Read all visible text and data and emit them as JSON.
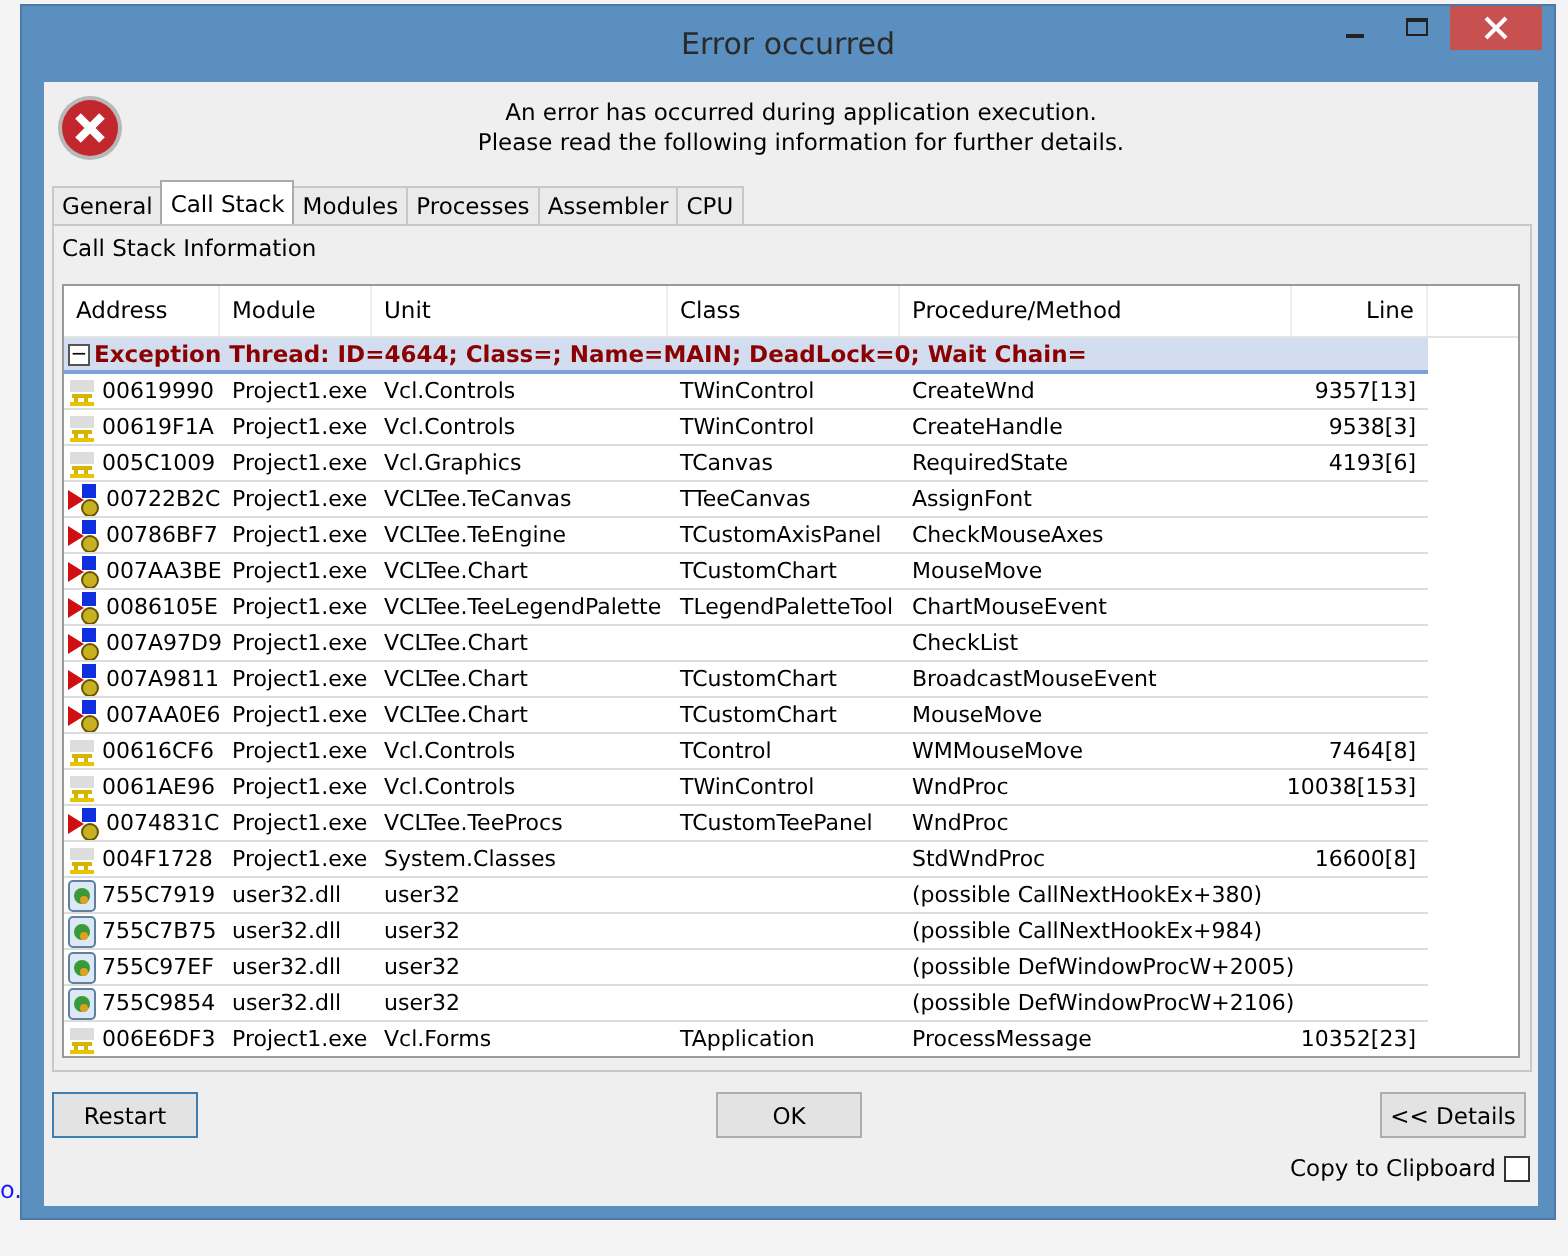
{
  "background": {
    "text": "o."
  },
  "window": {
    "title": "Error occurred"
  },
  "message": [
    "An error has occurred during application execution.",
    "Please read the following information for further details."
  ],
  "tabs": [
    {
      "label": "General",
      "selected": false
    },
    {
      "label": "Call Stack",
      "selected": true
    },
    {
      "label": "Modules",
      "selected": false
    },
    {
      "label": "Processes",
      "selected": false
    },
    {
      "label": "Assembler",
      "selected": false
    },
    {
      "label": "CPU",
      "selected": false
    }
  ],
  "section_title": "Call Stack Information",
  "table": {
    "columns": [
      "Address",
      "Module",
      "Unit",
      "Class",
      "Procedure/Method",
      "Line"
    ],
    "group": {
      "label": "Exception Thread: ID=4644; Class=; Name=MAIN; DeadLock=0; Wait Chain=",
      "expanded": true,
      "expander": "−"
    },
    "rows": [
      {
        "kind": "source",
        "cells": [
          "00619990",
          "Project1.exe",
          "Vcl.Controls",
          "TWinControl",
          "CreateWnd",
          "9357[13]"
        ]
      },
      {
        "kind": "source",
        "cells": [
          "00619F1A",
          "Project1.exe",
          "Vcl.Controls",
          "TWinControl",
          "CreateHandle",
          "9538[3]"
        ]
      },
      {
        "kind": "source",
        "cells": [
          "005C1009",
          "Project1.exe",
          "Vcl.Graphics",
          "TCanvas",
          "RequiredState",
          "4193[6]"
        ]
      },
      {
        "kind": "method",
        "cells": [
          "00722B2C",
          "Project1.exe",
          "VCLTee.TeCanvas",
          "TTeeCanvas",
          "AssignFont",
          ""
        ]
      },
      {
        "kind": "method",
        "cells": [
          "00786BF7",
          "Project1.exe",
          "VCLTee.TeEngine",
          "TCustomAxisPanel",
          "CheckMouseAxes",
          ""
        ]
      },
      {
        "kind": "method",
        "cells": [
          "007AA3BE",
          "Project1.exe",
          "VCLTee.Chart",
          "TCustomChart",
          "MouseMove",
          ""
        ]
      },
      {
        "kind": "method",
        "cells": [
          "0086105E",
          "Project1.exe",
          "VCLTee.TeeLegendPalette",
          "TLegendPaletteTool",
          "ChartMouseEvent",
          ""
        ]
      },
      {
        "kind": "method",
        "cells": [
          "007A97D9",
          "Project1.exe",
          "VCLTee.Chart",
          "",
          "CheckList",
          ""
        ]
      },
      {
        "kind": "method",
        "cells": [
          "007A9811",
          "Project1.exe",
          "VCLTee.Chart",
          "TCustomChart",
          "BroadcastMouseEvent",
          ""
        ]
      },
      {
        "kind": "method",
        "cells": [
          "007AA0E6",
          "Project1.exe",
          "VCLTee.Chart",
          "TCustomChart",
          "MouseMove",
          ""
        ]
      },
      {
        "kind": "source",
        "cells": [
          "00616CF6",
          "Project1.exe",
          "Vcl.Controls",
          "TControl",
          "WMMouseMove",
          "7464[8]"
        ]
      },
      {
        "kind": "source",
        "cells": [
          "0061AE96",
          "Project1.exe",
          "Vcl.Controls",
          "TWinControl",
          "WndProc",
          "10038[153]"
        ]
      },
      {
        "kind": "method",
        "cells": [
          "0074831C",
          "Project1.exe",
          "VCLTee.TeeProcs",
          "TCustomTeePanel",
          "WndProc",
          ""
        ]
      },
      {
        "kind": "source",
        "cells": [
          "004F1728",
          "Project1.exe",
          "System.Classes",
          "",
          "StdWndProc",
          "16600[8]"
        ]
      },
      {
        "kind": "dll",
        "cells": [
          "755C7919",
          "user32.dll",
          "user32",
          "",
          " (possible CallNextHookEx+380)",
          ""
        ]
      },
      {
        "kind": "dll",
        "cells": [
          "755C7B75",
          "user32.dll",
          "user32",
          "",
          " (possible CallNextHookEx+984)",
          ""
        ]
      },
      {
        "kind": "dll",
        "cells": [
          "755C97EF",
          "user32.dll",
          "user32",
          "",
          " (possible DefWindowProcW+2005)",
          ""
        ]
      },
      {
        "kind": "dll",
        "cells": [
          "755C9854",
          "user32.dll",
          "user32",
          "",
          " (possible DefWindowProcW+2106)",
          ""
        ]
      },
      {
        "kind": "source",
        "cells": [
          "006E6DF3",
          "Project1.exe",
          "Vcl.Forms",
          "TApplication",
          "ProcessMessage",
          "10352[23]"
        ]
      }
    ]
  },
  "buttons": {
    "restart": "Restart",
    "ok": "OK",
    "details": "<< Details"
  },
  "copy_to_clipboard": {
    "label": "Copy to Clipboard",
    "checked": false
  }
}
